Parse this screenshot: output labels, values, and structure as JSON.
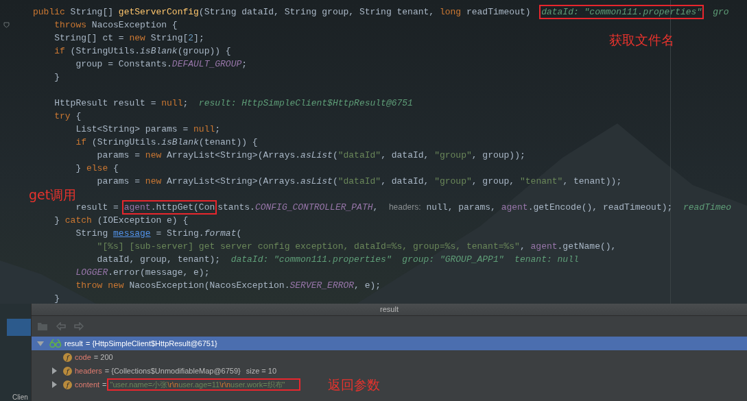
{
  "editor": {
    "lines": [
      {
        "kind": "code",
        "tokens": [
          {
            "kind": "kw",
            "text": "public "
          },
          {
            "kind": "plain",
            "text": "String[] "
          },
          {
            "kind": "decl",
            "text": "getServerConfig"
          },
          {
            "kind": "plain",
            "text": "(String dataId, String group, String tenant, "
          },
          {
            "kind": "kw",
            "text": "long "
          },
          {
            "kind": "plain",
            "text": "readTimeout)  "
          },
          {
            "kind": "box",
            "parts": [
              {
                "kind": "hint",
                "text": "dataId: \"common111.properties\""
              }
            ]
          },
          {
            "kind": "hint",
            "text": "gro"
          }
        ]
      },
      {
        "kind": "code",
        "tokens": [
          {
            "kind": "kw",
            "text": "    throws "
          },
          {
            "kind": "plain",
            "text": "NacosException {"
          }
        ]
      },
      {
        "kind": "code",
        "tokens": [
          {
            "kind": "plain",
            "text": "    String[] ct = "
          },
          {
            "kind": "kw",
            "text": "new "
          },
          {
            "kind": "plain",
            "text": "String["
          },
          {
            "kind": "num",
            "text": "2"
          },
          {
            "kind": "plain",
            "text": "];"
          }
        ]
      },
      {
        "kind": "code",
        "tokens": [
          {
            "kind": "kw",
            "text": "    if "
          },
          {
            "kind": "plain",
            "text": "(StringUtils."
          },
          {
            "kind": "static",
            "text": "isBlank"
          },
          {
            "kind": "plain",
            "text": "(group)) {"
          }
        ]
      },
      {
        "kind": "code",
        "tokens": [
          {
            "kind": "plain",
            "text": "        group = Constants."
          },
          {
            "kind": "const",
            "text": "DEFAULT_GROUP"
          },
          {
            "kind": "plain",
            "text": ";"
          }
        ]
      },
      {
        "kind": "code",
        "tokens": [
          {
            "kind": "plain",
            "text": "    }"
          }
        ]
      },
      {
        "kind": "blank"
      },
      {
        "kind": "code",
        "tokens": [
          {
            "kind": "plain",
            "text": "    HttpResult result = "
          },
          {
            "kind": "kw",
            "text": "null"
          },
          {
            "kind": "plain",
            "text": ";  "
          },
          {
            "kind": "hint",
            "text": "result: HttpSimpleClient$HttpResult@6751"
          }
        ]
      },
      {
        "kind": "code",
        "tokens": [
          {
            "kind": "kw",
            "text": "    try "
          },
          {
            "kind": "plain",
            "text": "{"
          }
        ]
      },
      {
        "kind": "code",
        "tokens": [
          {
            "kind": "plain",
            "text": "        List<String> params = "
          },
          {
            "kind": "kw",
            "text": "null"
          },
          {
            "kind": "plain",
            "text": ";"
          }
        ]
      },
      {
        "kind": "code",
        "tokens": [
          {
            "kind": "kw",
            "text": "        if "
          },
          {
            "kind": "plain",
            "text": "(StringUtils."
          },
          {
            "kind": "static",
            "text": "isBlank"
          },
          {
            "kind": "plain",
            "text": "(tenant)) {"
          }
        ]
      },
      {
        "kind": "code",
        "tokens": [
          {
            "kind": "plain",
            "text": "            params = "
          },
          {
            "kind": "kw",
            "text": "new "
          },
          {
            "kind": "plain",
            "text": "ArrayList<String>(Arrays."
          },
          {
            "kind": "static",
            "text": "asList"
          },
          {
            "kind": "plain",
            "text": "("
          },
          {
            "kind": "str",
            "text": "\"dataId\""
          },
          {
            "kind": "plain",
            "text": ", dataId, "
          },
          {
            "kind": "str",
            "text": "\"group\""
          },
          {
            "kind": "plain",
            "text": ", group));"
          }
        ]
      },
      {
        "kind": "code",
        "tokens": [
          {
            "kind": "plain",
            "text": "        } "
          },
          {
            "kind": "kw",
            "text": "else "
          },
          {
            "kind": "plain",
            "text": "{"
          }
        ]
      },
      {
        "kind": "code",
        "tokens": [
          {
            "kind": "plain",
            "text": "            params = "
          },
          {
            "kind": "kw",
            "text": "new "
          },
          {
            "kind": "plain",
            "text": "ArrayList<String>(Arrays."
          },
          {
            "kind": "static",
            "text": "asList"
          },
          {
            "kind": "plain",
            "text": "("
          },
          {
            "kind": "str",
            "text": "\"dataId\""
          },
          {
            "kind": "plain",
            "text": ", dataId, "
          },
          {
            "kind": "str",
            "text": "\"group\""
          },
          {
            "kind": "plain",
            "text": ", group, "
          },
          {
            "kind": "str",
            "text": "\"tenant\""
          },
          {
            "kind": "plain",
            "text": ", tenant));"
          }
        ]
      },
      {
        "kind": "blank"
      },
      {
        "kind": "code",
        "tokens": [
          {
            "kind": "plain",
            "text": "        result = "
          },
          {
            "kind": "box",
            "parts": [
              {
                "kind": "field",
                "text": "agent"
              },
              {
                "kind": "plain",
                "text": ".httpGet(Con"
              }
            ]
          },
          {
            "kind": "plain",
            "text": "stants."
          },
          {
            "kind": "const",
            "text": "CONFIG_CONTROLLER_PATH"
          },
          {
            "kind": "plain",
            "text": ",  "
          },
          {
            "kind": "phint",
            "text": "headers:"
          },
          {
            "kind": "plain",
            "text": " null, params, "
          },
          {
            "kind": "field",
            "text": "agent"
          },
          {
            "kind": "plain",
            "text": ".getEncode(), readTimeout);  "
          },
          {
            "kind": "hint",
            "text": "readTimeo"
          }
        ]
      },
      {
        "kind": "code",
        "tokens": [
          {
            "kind": "plain",
            "text": "    } "
          },
          {
            "kind": "kw",
            "text": "catch "
          },
          {
            "kind": "plain",
            "text": "(IOException e) {"
          }
        ]
      },
      {
        "kind": "code",
        "tokens": [
          {
            "kind": "plain",
            "text": "        String "
          },
          {
            "kind": "link",
            "text": "message"
          },
          {
            "kind": "plain",
            "text": " = String."
          },
          {
            "kind": "static",
            "text": "format"
          },
          {
            "kind": "plain",
            "text": "("
          }
        ]
      },
      {
        "kind": "code",
        "tokens": [
          {
            "kind": "str",
            "text": "            \"[%s] [sub-server] get server config exception, dataId=%s, group=%s, tenant=%s\""
          },
          {
            "kind": "plain",
            "text": ", "
          },
          {
            "kind": "field",
            "text": "agent"
          },
          {
            "kind": "plain",
            "text": ".getName(),"
          }
        ]
      },
      {
        "kind": "code",
        "tokens": [
          {
            "kind": "plain",
            "text": "            dataId, group, tenant);  "
          },
          {
            "kind": "hint",
            "text": "dataId: \"common111.properties\"  group: \"GROUP_APP1\"  tenant: null"
          }
        ]
      },
      {
        "kind": "code",
        "tokens": [
          {
            "kind": "const",
            "text": "        LOGGER"
          },
          {
            "kind": "plain",
            "text": ".error(message, e);"
          }
        ]
      },
      {
        "kind": "code",
        "tokens": [
          {
            "kind": "kw",
            "text": "        throw new "
          },
          {
            "kind": "plain",
            "text": "NacosException(NacosException."
          },
          {
            "kind": "const",
            "text": "SERVER_ERROR"
          },
          {
            "kind": "plain",
            "text": ", e);"
          }
        ]
      },
      {
        "kind": "code",
        "tokens": [
          {
            "kind": "plain",
            "text": "    }"
          }
        ]
      }
    ]
  },
  "annotations": [
    "获取文件名",
    "get调用",
    "返回参数"
  ],
  "debugger": {
    "title": "result",
    "nodes": [
      {
        "kind": "object",
        "expandable": true,
        "expanded": true,
        "selected": true,
        "name": "result",
        "value": "= {HttpSimpleClient$HttpResult@6751}",
        "children": [
          {
            "kind": "field",
            "badge": "f",
            "expandable": false,
            "selected": false,
            "name": "code",
            "value": "= 200"
          },
          {
            "kind": "field",
            "badge": "f",
            "expandable": true,
            "expanded": false,
            "selected": false,
            "name": "headers",
            "value": "= {Collections$UnmodifiableMap@6759}",
            "extra": "size = 10"
          },
          {
            "kind": "field",
            "badge": "f",
            "expandable": true,
            "expanded": false,
            "selected": false,
            "name": "content",
            "value": "= ",
            "boxed": true,
            "value_parts": [
              {
                "kind": "str",
                "text": "\"user.name=小张"
              },
              {
                "kind": "esc",
                "text": "\\r\\n"
              },
              {
                "kind": "str",
                "text": "user.age=11"
              },
              {
                "kind": "esc",
                "text": "\\r\\n"
              },
              {
                "kind": "str",
                "text": "user.work=织布\""
              }
            ]
          }
        ]
      }
    ]
  },
  "bottom_tab": "Clien"
}
